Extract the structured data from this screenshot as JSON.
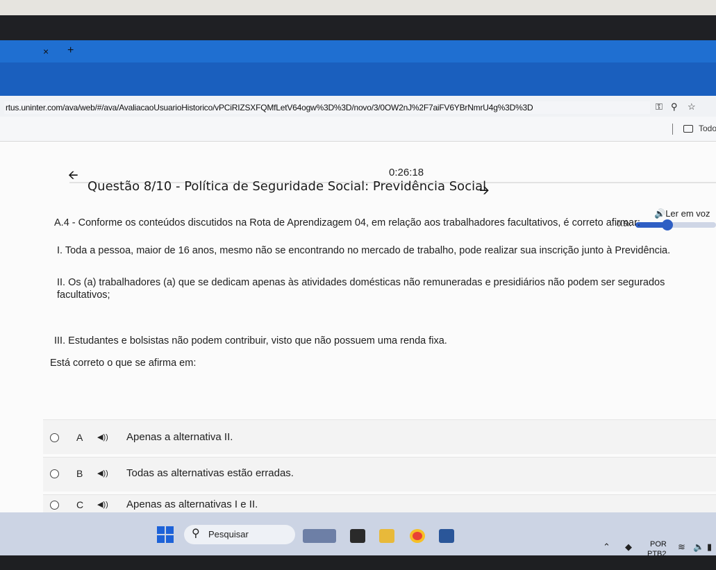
{
  "browser": {
    "tab_close": "×",
    "tab_new": "+",
    "url": "rtus.uninter.com/ava/web/#/ava/AvaliacaoUsuarioHistorico/vPCiRIZSXFQMfLetV64ogw%3D%3D/novo/3/0OW2nJ%2F7aiFV6YBrNmrU4g%3D%3D",
    "bookmark_label": "Todo"
  },
  "page": {
    "timer": "0:26:18",
    "title": "Questão 8/10 - Política de Seguridade Social: Previdência Social",
    "tts_label": "Ler em voz",
    "speed": "0.5x",
    "speed_level": 0.4,
    "question_intro": "A.4 - Conforme os conteúdos discutidos na Rota de Aprendizagem 04, em relação aos trabalhadores facultativos, é correto afirmar:",
    "statement_i": "I. Toda a pessoa, maior de 16 anos, mesmo não se encontrando no mercado de trabalho, pode realizar sua inscrição junto à Previdência.",
    "statement_ii": "II. Os (a) trabalhadores (a) que se dedicam apenas às atividades domésticas não remuneradas e presidiários não podem ser segurados facultativos;",
    "statement_iii": "III. Estudantes e bolsistas não podem contribuir, visto que não possuem uma renda fixa.",
    "prompt": "Está correto o que se afirma em:",
    "options": [
      {
        "letter": "A",
        "text": "Apenas a alternativa II."
      },
      {
        "letter": "B",
        "text": "Todas as alternativas estão erradas."
      },
      {
        "letter": "C",
        "text": "Apenas as alternativas I e II."
      }
    ]
  },
  "taskbar": {
    "search_placeholder": "Pesquisar",
    "lang_top": "POR",
    "lang_bottom": "PTB2"
  },
  "colors": {
    "browser_blue": "#1a5fbe",
    "accent": "#2f5fc4",
    "windows_blue": "#1d62d8"
  }
}
